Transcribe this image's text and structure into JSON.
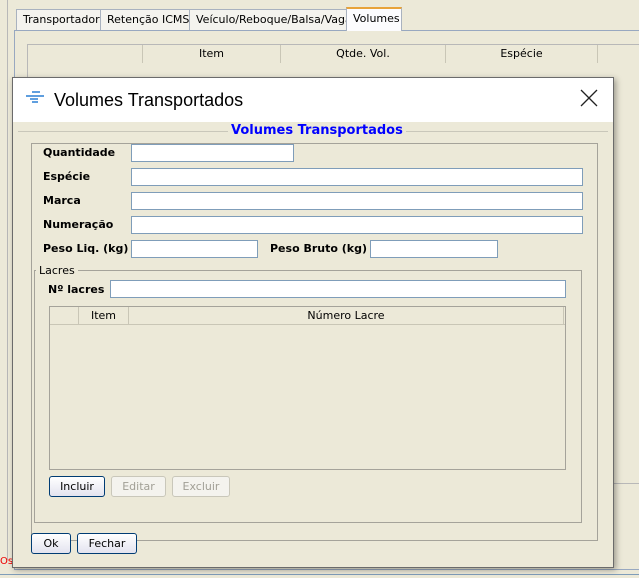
{
  "main": {
    "tabs": [
      {
        "label": "Transportador"
      },
      {
        "label": "Retenção ICMS"
      },
      {
        "label": "Veículo/Reboque/Balsa/Vagão"
      },
      {
        "label": "Volumes"
      }
    ],
    "table_headers": [
      "",
      "Item",
      "Qtde. Vol.",
      "Espécie"
    ],
    "status_text": "Os"
  },
  "dialog": {
    "title": "Volumes Transportados",
    "icon": "sefaz-logo-icon",
    "group_title": "Volumes Transportados",
    "fields": {
      "quantidade": {
        "label": "Quantidade",
        "value": ""
      },
      "especie": {
        "label": "Espécie",
        "value": ""
      },
      "marca": {
        "label": "Marca",
        "value": ""
      },
      "numeracao": {
        "label": "Numeração",
        "value": ""
      },
      "peso_liq": {
        "label": "Peso Liq. (kg)",
        "value": ""
      },
      "peso_bruto": {
        "label": "Peso Bruto (kg)",
        "value": ""
      }
    },
    "lacres": {
      "title": "Lacres",
      "n_lacres_label": "Nº lacres",
      "n_lacres_value": "",
      "table_headers": [
        "",
        "Item",
        "Número Lacre"
      ],
      "buttons": {
        "incluir": "Incluir",
        "editar": "Editar",
        "excluir": "Excluir"
      }
    },
    "buttons": {
      "ok": "Ok",
      "fechar": "Fechar"
    },
    "title_color": "#0000ff"
  }
}
